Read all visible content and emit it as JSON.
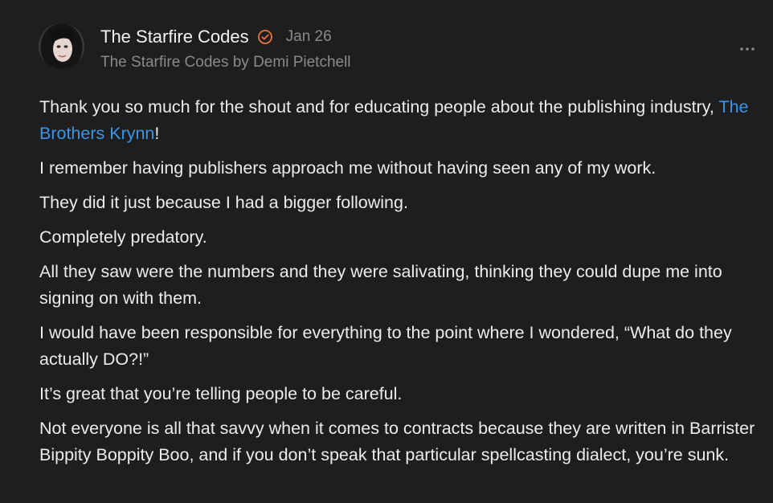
{
  "comment": {
    "author_name": "The Starfire Codes",
    "date": "Jan 26",
    "byline": "The Starfire Codes by Demi Pietchell",
    "icons": {
      "avatar": "avatar",
      "verified": "verified-check-icon",
      "more": "more-options-icon"
    },
    "accent_color": "#e8743b",
    "link_color": "#3b95e8",
    "p1_before": "Thank you so much for the shout and for educating people about the publishing industry, ",
    "p1_mention": "The Brothers Krynn",
    "p1_after": "!",
    "paragraphs": [
      "I remember having publishers approach me without having seen any of my work.",
      "They did it just because I had a bigger following.",
      "Completely predatory.",
      "All they saw were the numbers and they were salivating, thinking they could dupe me into signing on with them.",
      "I would have been responsible for everything to the point where I wondered, “What do they actually DO?!”",
      "It’s great that you’re telling people to be careful.",
      "Not everyone is all that savvy when it comes to contracts because they are written in Barrister Bippity Boppity Boo, and if you don’t speak that particular spellcasting dialect, you’re sunk."
    ]
  }
}
